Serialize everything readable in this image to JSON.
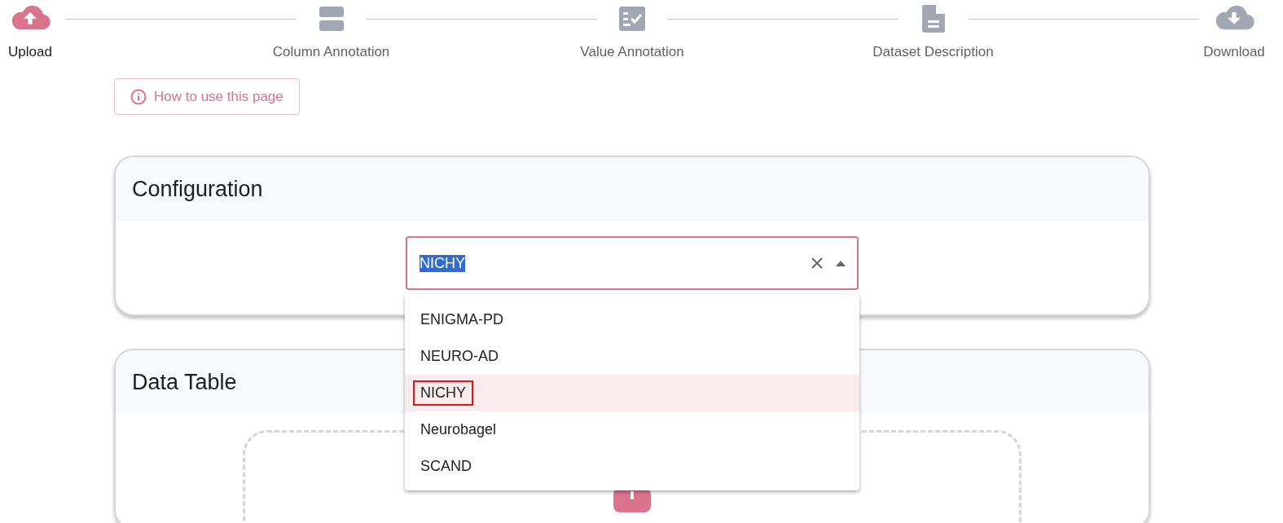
{
  "stepper": {
    "steps": [
      {
        "label": "Upload",
        "kind": "upload",
        "selected": true
      },
      {
        "label": "Column Annotation",
        "kind": "columns",
        "selected": false
      },
      {
        "label": "Value Annotation",
        "kind": "checklist",
        "selected": false
      },
      {
        "label": "Dataset Description",
        "kind": "document",
        "selected": false
      },
      {
        "label": "Download",
        "kind": "download",
        "selected": false
      }
    ]
  },
  "help_button": {
    "label": "How to use this page"
  },
  "configuration": {
    "title": "Configuration",
    "select": {
      "value": "NICHY",
      "expanded": true,
      "options": [
        {
          "label": "ENIGMA-PD",
          "selected": false
        },
        {
          "label": "NEURO-AD",
          "selected": false
        },
        {
          "label": "NICHY",
          "selected": true
        },
        {
          "label": "Neurobagel",
          "selected": false
        },
        {
          "label": "SCAND",
          "selected": false
        }
      ]
    }
  },
  "data_table": {
    "title": "Data Table"
  }
}
